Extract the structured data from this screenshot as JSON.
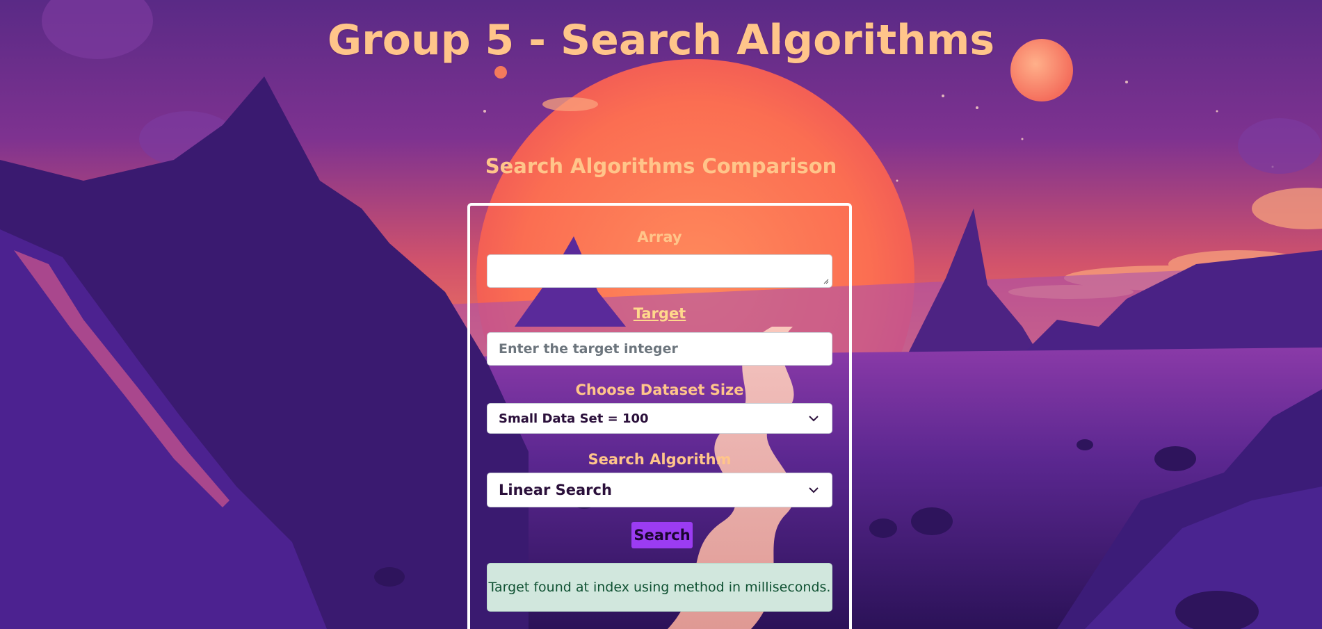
{
  "page": {
    "title": "Group 5 - Search Algorithms",
    "subtitle": "Search Algorithms Comparison"
  },
  "form": {
    "array_label": "Array",
    "array_value": "",
    "target_label": "Target",
    "target_placeholder": "Enter the target integer",
    "dataset_label": "Choose Dataset Size",
    "dataset_selected": "Small Data Set = 100",
    "algorithm_label": "Search Algorithm",
    "algorithm_selected": "Linear Search",
    "search_button": "Search"
  },
  "result": {
    "message": "Target found at index using method in milliseconds."
  },
  "theme": {
    "title_color": "#ffc58a",
    "button_color": "#9b3cf2",
    "result_bg": "#d1e7dd",
    "result_text": "#0f5132"
  },
  "icons": {
    "dataset_dropdown": "chevron-down-icon",
    "algorithm_dropdown": "chevron-down-icon",
    "textarea_resize": "resize-grip-icon"
  }
}
